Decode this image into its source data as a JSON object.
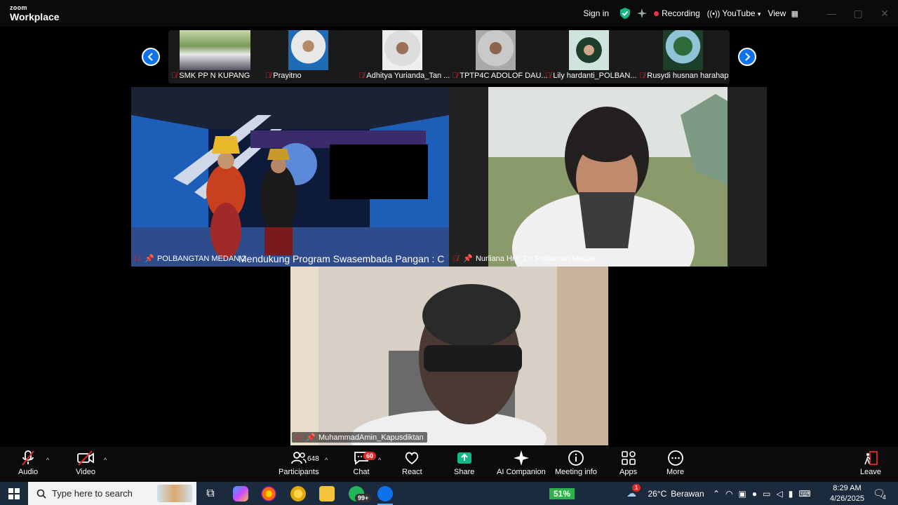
{
  "titlebar": {
    "logo_small": "zoom",
    "logo_big": "Workplace",
    "sign_in": "Sign in",
    "recording": "Recording",
    "youtube": "YouTube",
    "view": "View",
    "shield_color": "#12b886"
  },
  "gallery": {
    "thumbnails": [
      {
        "name": "SMK PP N KUPANG"
      },
      {
        "name": "Prayitno"
      },
      {
        "name": "Adhitya Yurianda_Tan ..."
      },
      {
        "name": "TPTP4C ADOLOF DAU..."
      },
      {
        "name": "Lily hardanti_POLBAN..."
      },
      {
        "name": "Rusydi husnan harahap"
      }
    ]
  },
  "tiles": {
    "studio": {
      "name": "POLBANGTAN MEDAN 2",
      "caption": "Mendukung Program Swasembada Pangan : C"
    },
    "woman": {
      "name": "Nurliana Hrp_Dir Polbantan Medan"
    },
    "man": {
      "name": "MuhammadAmin_Kapusdiktan"
    }
  },
  "toolbar": {
    "audio": "Audio",
    "video": "Video",
    "participants": "Participants",
    "participants_count": "648",
    "chat": "Chat",
    "chat_badge": "60",
    "react": "React",
    "share": "Share",
    "ai_companion": "AI Companion",
    "meeting_info": "Meeting info",
    "apps": "Apps",
    "more": "More",
    "leave": "Leave",
    "share_color": "#12b886",
    "leave_color": "#e02828"
  },
  "taskbar": {
    "search_placeholder": "Type here to search",
    "whatsapp_badge": "99+",
    "battery": "51%",
    "weather_temp": "26°C",
    "weather_text": "Berawan",
    "time": "8:29 AM",
    "date": "4/26/2025",
    "notif_count": "4",
    "weather_alert": "1"
  }
}
